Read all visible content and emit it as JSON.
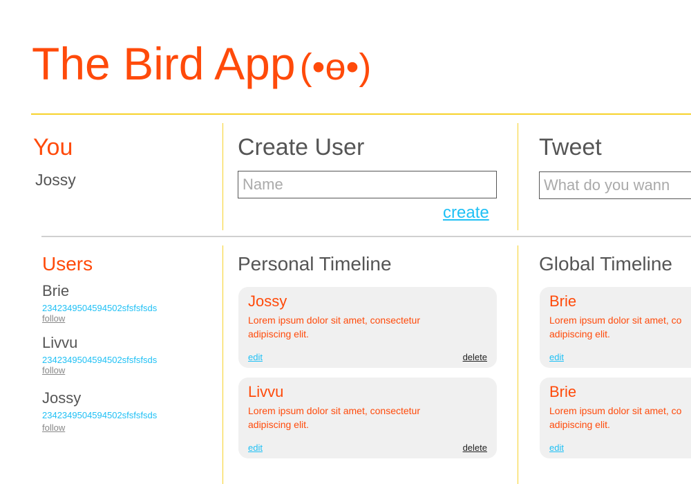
{
  "app": {
    "title": "The Bird App",
    "logo_face": "(•ө•)"
  },
  "colors": {
    "accent": "#ff4a0a",
    "link": "#1fc0f5",
    "divider": "#f7d22a"
  },
  "you": {
    "heading": "You",
    "name": "Jossy"
  },
  "create_user": {
    "heading": "Create User",
    "name_placeholder": "Name",
    "name_value": "",
    "create_label": "create"
  },
  "tweet": {
    "heading": "Tweet",
    "placeholder": "What do you wann"
  },
  "users": {
    "heading": "Users",
    "items": [
      {
        "name": "Brie",
        "id": "2342349504594502sfsfsfsds",
        "follow": "follow"
      },
      {
        "name": "Livvu",
        "id": "2342349504594502sfsfsfsds",
        "follow": "follow"
      },
      {
        "name": "Jossy",
        "id": "2342349504594502sfsfsfsds",
        "follow": "follow"
      }
    ]
  },
  "personal_timeline": {
    "heading": "Personal Timeline",
    "tweets": [
      {
        "author": "Jossy",
        "text": "Lorem ipsum dolor sit amet, consectetur adipiscing elit.",
        "edit": "edit",
        "delete": "delete"
      },
      {
        "author": "Livvu",
        "text": "Lorem ipsum dolor sit amet, consectetur adipiscing elit.",
        "edit": "edit",
        "delete": "delete"
      }
    ]
  },
  "global_timeline": {
    "heading": "Global Timeline",
    "tweets": [
      {
        "author": "Brie",
        "line1": "Lorem ipsum dolor sit amet, co",
        "line2": "adipiscing elit.",
        "edit": "edit"
      },
      {
        "author": "Brie",
        "line1": "Lorem ipsum dolor sit amet, co",
        "line2": "adipiscing elit.",
        "edit": "edit"
      }
    ]
  }
}
